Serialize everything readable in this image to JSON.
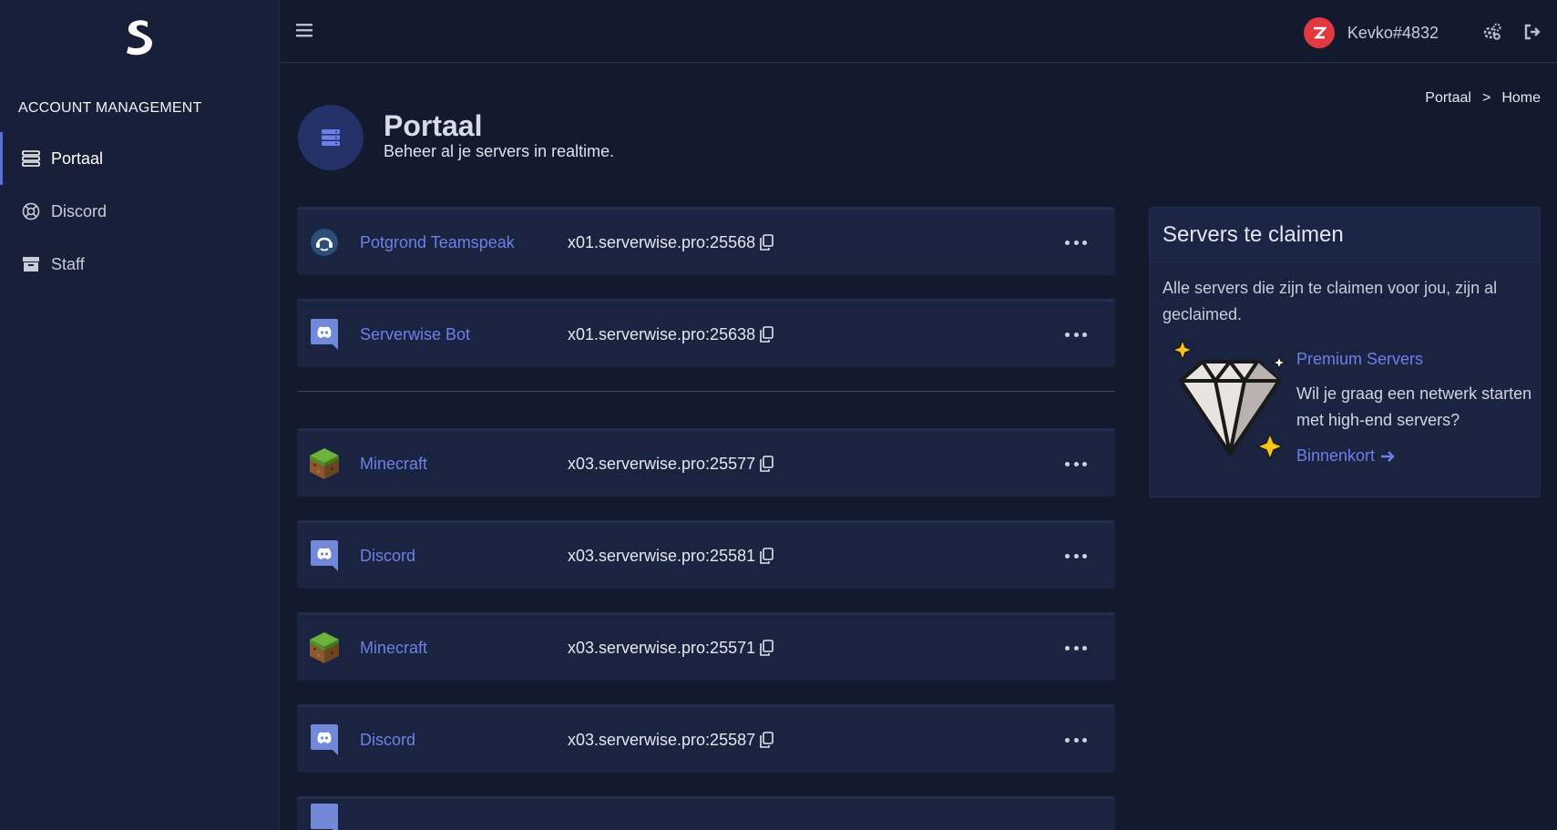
{
  "sidebar": {
    "section_title": "ACCOUNT MANAGEMENT",
    "items": [
      {
        "label": "Portaal",
        "icon": "server-icon",
        "active": true
      },
      {
        "label": "Discord",
        "icon": "lifebuoy-icon",
        "active": false
      },
      {
        "label": "Staff",
        "icon": "archive-icon",
        "active": false
      }
    ]
  },
  "topbar": {
    "user_name": "Kevko#4832",
    "avatar_color": "#e2383f"
  },
  "page": {
    "title": "Portaal",
    "subtitle": "Beheer al je servers in realtime."
  },
  "breadcrumb": {
    "items": [
      "Portaal",
      "Home"
    ],
    "separator": ">"
  },
  "servers": [
    {
      "name": "Potgrond Teamspeak",
      "address": "x01.serverwise.pro:25568",
      "icon": "teamspeak-icon"
    },
    {
      "name": "Serverwise Bot",
      "address": "x01.serverwise.pro:25638",
      "icon": "discord-icon"
    },
    {
      "name": "Minecraft",
      "address": "x03.serverwise.pro:25577",
      "icon": "minecraft-icon"
    },
    {
      "name": "Discord",
      "address": "x03.serverwise.pro:25581",
      "icon": "discord-icon"
    },
    {
      "name": "Minecraft",
      "address": "x03.serverwise.pro:25571",
      "icon": "minecraft-icon"
    },
    {
      "name": "Discord",
      "address": "x03.serverwise.pro:25587",
      "icon": "discord-icon"
    }
  ],
  "claim": {
    "title": "Servers te claimen",
    "text": "Alle servers die zijn te claimen voor jou, zijn al geclaimed.",
    "premium_title": "Premium Servers",
    "premium_text": "Wil je graag een netwerk starten met high-end servers?",
    "premium_link": "Binnenkort"
  },
  "colors": {
    "accent": "#6c80e8",
    "background": "#141a2e",
    "card": "#1a2340",
    "sidebar": "#182039"
  }
}
